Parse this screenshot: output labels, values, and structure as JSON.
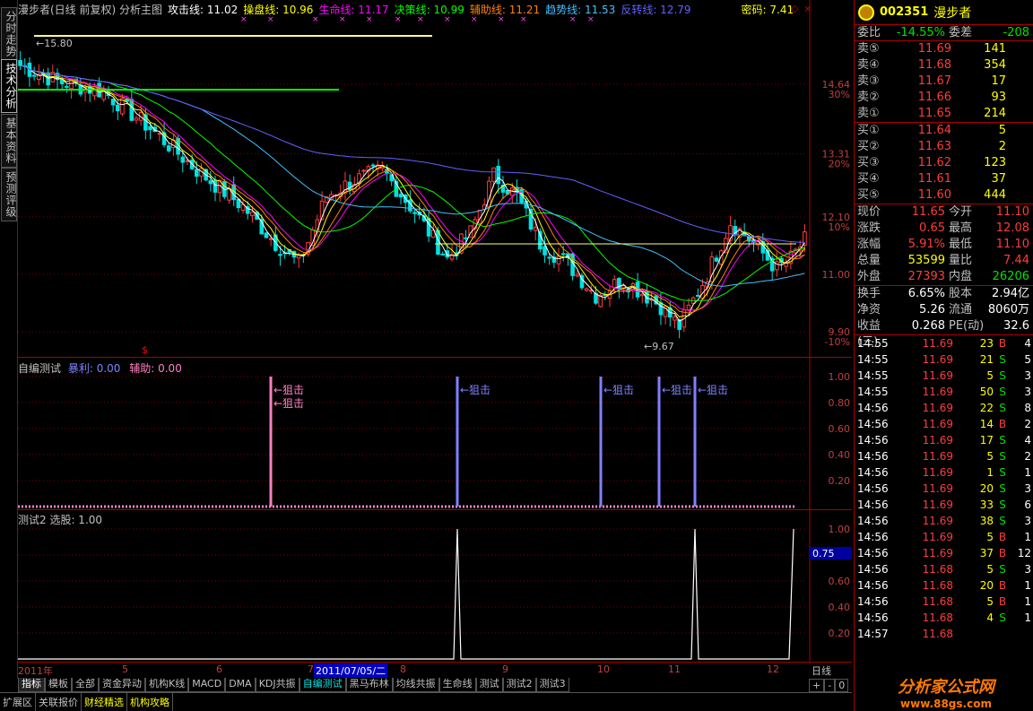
{
  "left_tabs": [
    "分时走势",
    "技术分析",
    "基本资料",
    "预测评级"
  ],
  "header": {
    "title": "漫步者(日线 前复权) 分析主图",
    "items": [
      {
        "label": "攻击线: 11.02",
        "color": "#ffffff"
      },
      {
        "label": "操盘线: 10.96",
        "color": "#ffff00"
      },
      {
        "label": "生命线: 11.17",
        "color": "#ff00ff"
      },
      {
        "label": "决策线: 10.99",
        "color": "#00ff00"
      },
      {
        "label": "辅助线: 11.21",
        "color": "#ff8000"
      },
      {
        "label": "趋势线: 11.53",
        "color": "#40c0ff"
      },
      {
        "label": "反转线: 12.79",
        "color": "#6060ff"
      },
      {
        "label": "密码: 7.41",
        "color": "#ffff00"
      }
    ]
  },
  "kline": {
    "y_ticks": [
      {
        "v": "14.64",
        "p": "30%"
      },
      {
        "v": "13.31",
        "p": "20%"
      },
      {
        "v": "12.10",
        "p": "10%"
      },
      {
        "v": "11.00",
        "p": ""
      },
      {
        "v": "9.90",
        "p": "-10%"
      }
    ],
    "high_label": "15.80",
    "low_label": "9.67",
    "dollar": "$"
  },
  "ind1": {
    "title": "自编测试",
    "k1": "暴利: 0.00",
    "k2": "辅助: 0.00",
    "ticks": [
      "1.00",
      "0.80",
      "0.60",
      "0.40",
      "0.20"
    ],
    "label": "←狙击"
  },
  "ind2": {
    "title": "测试2 选股: 1.00",
    "ticks": [
      "1.00",
      "0.80",
      "0.60",
      "0.40",
      "0.20"
    ],
    "current": "0.75"
  },
  "xaxis": {
    "labels": [
      "2011年",
      "5",
      "6",
      "7",
      "8",
      "9",
      "10",
      "11",
      "12"
    ],
    "cursor": "2011/07/05/二",
    "period": "日线"
  },
  "tabs": [
    "指标",
    "模板",
    "全部",
    "资金异动",
    "机构K线",
    "MACD",
    "DMA",
    "KDJ共振",
    "自编测试",
    "黑马布林",
    "均线共振",
    "生命线",
    "测试",
    "测试2",
    "测试3"
  ],
  "zoom": [
    "+",
    "-",
    "0"
  ],
  "bottom": [
    "扩展区",
    "关联报价",
    "财经精选",
    "机构攻略"
  ],
  "quote": {
    "code": "002351",
    "name": "漫步者",
    "webi": "委比",
    "webi_v": "-14.55%",
    "wecha": "委差",
    "wecha_v": "-208",
    "sells": [
      {
        "n": "卖⑤",
        "p": "11.69",
        "s": "141"
      },
      {
        "n": "卖④",
        "p": "11.68",
        "s": "354"
      },
      {
        "n": "卖③",
        "p": "11.67",
        "s": "17"
      },
      {
        "n": "卖②",
        "p": "11.66",
        "s": "93"
      },
      {
        "n": "卖①",
        "p": "11.65",
        "s": "214"
      }
    ],
    "buys": [
      {
        "n": "买①",
        "p": "11.64",
        "s": "5"
      },
      {
        "n": "买②",
        "p": "11.63",
        "s": "2"
      },
      {
        "n": "买③",
        "p": "11.62",
        "s": "123"
      },
      {
        "n": "买④",
        "p": "11.61",
        "s": "37"
      },
      {
        "n": "买⑤",
        "p": "11.60",
        "s": "444"
      }
    ],
    "stats": [
      [
        "现价",
        "11.65",
        "今开",
        "11.10"
      ],
      [
        "涨跌",
        "0.65",
        "最高",
        "12.08"
      ],
      [
        "涨幅",
        "5.91%",
        "最低",
        "11.10"
      ],
      [
        "总量",
        "53599",
        "量比",
        "7.44"
      ],
      [
        "外盘",
        "27393",
        "内盘",
        "26206"
      ]
    ],
    "stats2": [
      [
        "换手",
        "6.65%",
        "股本",
        "2.94亿"
      ],
      [
        "净资",
        "5.26",
        "流通",
        "8060万"
      ],
      [
        "收益(三)",
        "0.268",
        "PE(动)",
        "32.6"
      ]
    ],
    "ticks": [
      [
        "14:55",
        "11.69",
        "23",
        "B",
        "4"
      ],
      [
        "14:55",
        "11.69",
        "21",
        "S",
        "5"
      ],
      [
        "14:55",
        "11.69",
        "5",
        "S",
        "3"
      ],
      [
        "14:55",
        "11.69",
        "50",
        "S",
        "3"
      ],
      [
        "14:56",
        "11.69",
        "22",
        "S",
        "8"
      ],
      [
        "14:56",
        "11.69",
        "14",
        "B",
        "2"
      ],
      [
        "14:56",
        "11.69",
        "17",
        "S",
        "4"
      ],
      [
        "14:56",
        "11.69",
        "5",
        "S",
        "2"
      ],
      [
        "14:56",
        "11.69",
        "1",
        "S",
        "1"
      ],
      [
        "14:56",
        "11.69",
        "20",
        "S",
        "3"
      ],
      [
        "14:56",
        "11.69",
        "33",
        "S",
        "6"
      ],
      [
        "14:56",
        "11.69",
        "38",
        "S",
        "3"
      ],
      [
        "14:56",
        "11.69",
        "5",
        "B",
        "1"
      ],
      [
        "14:56",
        "11.69",
        "37",
        "B",
        "12"
      ],
      [
        "14:56",
        "11.68",
        "5",
        "S",
        "3"
      ],
      [
        "14:56",
        "11.68",
        "20",
        "B",
        "1"
      ],
      [
        "14:56",
        "11.68",
        "5",
        "B",
        "1"
      ],
      [
        "14:56",
        "11.68",
        "4",
        "S",
        "1"
      ],
      [
        "14:57",
        "11.68",
        "",
        "",
        ""
      ]
    ]
  },
  "watermark": {
    "cn": "分析家公式网",
    "url": "www.88gs.com"
  }
}
